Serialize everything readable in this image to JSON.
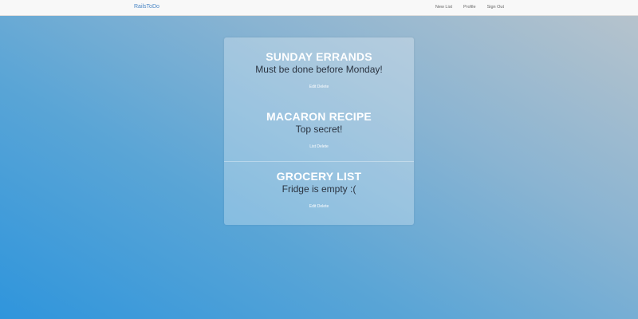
{
  "navbar": {
    "brand": "RailsToDo",
    "links": [
      "New List",
      "Profile",
      "Sign Out"
    ]
  },
  "lists": [
    {
      "title": "SUNDAY ERRANDS",
      "description": "Must be done before Monday!",
      "actions": [
        "Edit",
        "Delete"
      ]
    },
    {
      "title": "MACARON RECIPE",
      "description": "Top secret!",
      "actions": [
        "List",
        "Delete"
      ]
    },
    {
      "title": "GROCERY LIST",
      "description": "Fridge is empty :(",
      "actions": [
        "Edit",
        "Delete"
      ]
    }
  ],
  "colors": {
    "brand": "#4a86c5",
    "background_start": "#2f95dc",
    "background_end": "#b9c4cc"
  }
}
